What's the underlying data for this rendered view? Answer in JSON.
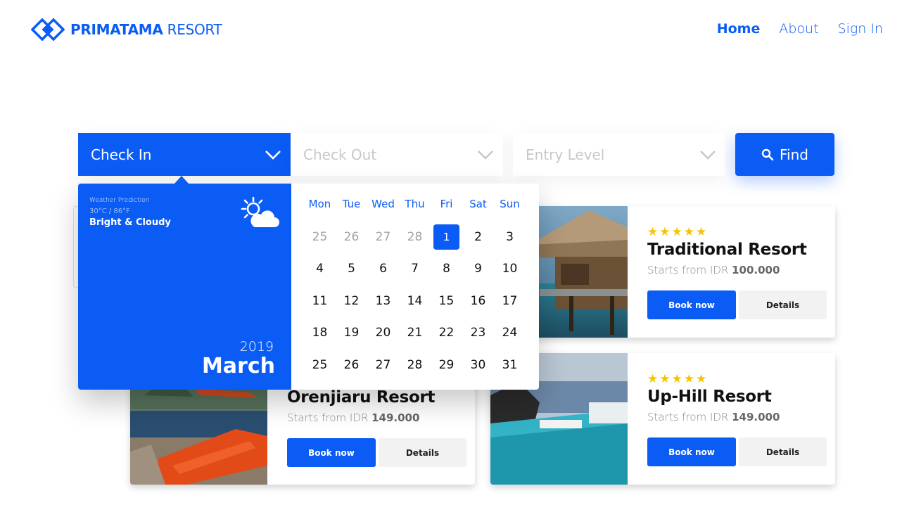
{
  "brand": {
    "name_bold": "PRIMATAMA",
    "name_light": " RESORT",
    "accent": "#0a5cf5"
  },
  "nav": {
    "home": "Home",
    "about": "About",
    "sign_in": "Sign In"
  },
  "search": {
    "check_in": "Check In",
    "check_out": "Check Out",
    "entry_level": "Entry Level",
    "find": "Find"
  },
  "weather": {
    "title": "Weather Prediction",
    "temperature": "30°C / 86°F",
    "description": "Bright & Cloudy",
    "icon": "sun-cloud-icon"
  },
  "calendar": {
    "year": "2019",
    "month": "March",
    "weekdays": [
      "Mon",
      "Tue",
      "Wed",
      "Thu",
      "Fri",
      "Sat",
      "Sun"
    ],
    "days": [
      {
        "d": "25",
        "muted": true
      },
      {
        "d": "26",
        "muted": true
      },
      {
        "d": "27",
        "muted": true
      },
      {
        "d": "28",
        "muted": true
      },
      {
        "d": "1",
        "selected": true
      },
      {
        "d": "2"
      },
      {
        "d": "3"
      },
      {
        "d": "4"
      },
      {
        "d": "5"
      },
      {
        "d": "6"
      },
      {
        "d": "7"
      },
      {
        "d": "8"
      },
      {
        "d": "9"
      },
      {
        "d": "10"
      },
      {
        "d": "11"
      },
      {
        "d": "12"
      },
      {
        "d": "13"
      },
      {
        "d": "14"
      },
      {
        "d": "15"
      },
      {
        "d": "16"
      },
      {
        "d": "17"
      },
      {
        "d": "18"
      },
      {
        "d": "19"
      },
      {
        "d": "20"
      },
      {
        "d": "21"
      },
      {
        "d": "22"
      },
      {
        "d": "23"
      },
      {
        "d": "24"
      },
      {
        "d": "25"
      },
      {
        "d": "26"
      },
      {
        "d": "27"
      },
      {
        "d": "28"
      },
      {
        "d": "29"
      },
      {
        "d": "30"
      },
      {
        "d": "31"
      }
    ]
  },
  "resorts": [
    {
      "name": "Traditional Resort",
      "price_prefix": "Starts from IDR ",
      "price": "100.000",
      "stars": 5,
      "rating": "★★★★★",
      "book": "Book now",
      "details": "Details"
    },
    {
      "name": "Orenjiaru Resort",
      "price_prefix": "Starts from IDR ",
      "price": "149.000",
      "book": "Book now",
      "details": "Details"
    },
    {
      "name": "Up-Hill Resort",
      "price_prefix": "Starts from IDR ",
      "price": "149.000",
      "stars": 5,
      "rating": "★★★★★",
      "book": "Book now",
      "details": "Details"
    }
  ]
}
